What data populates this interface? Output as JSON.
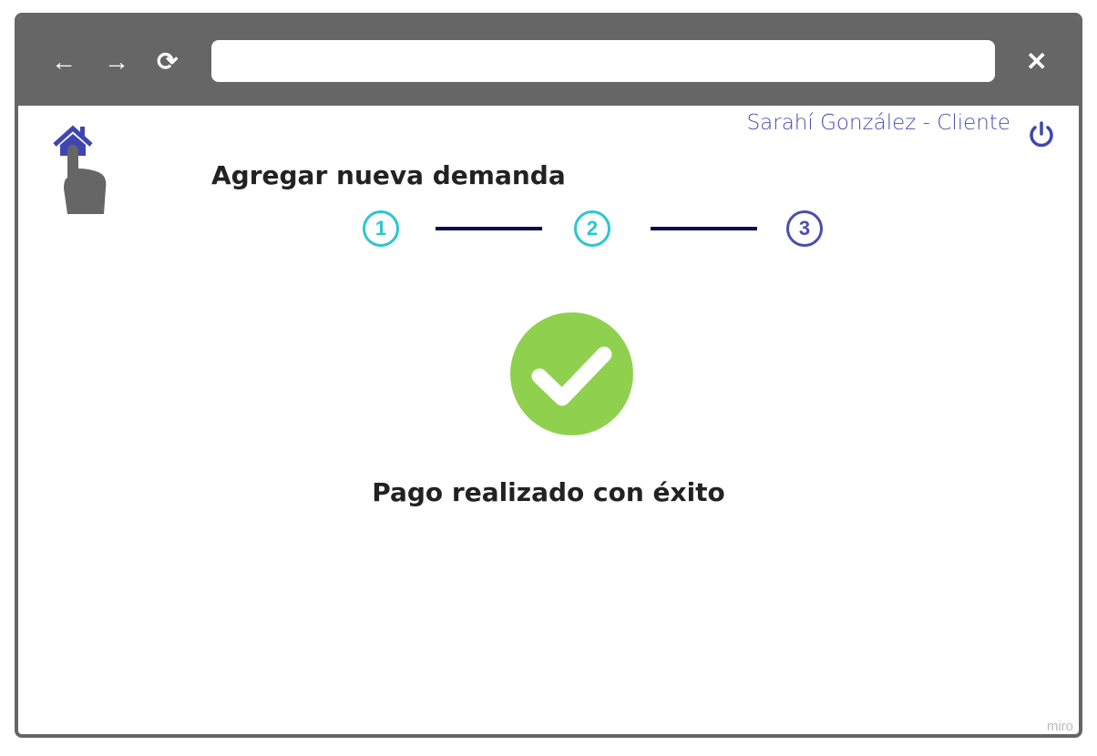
{
  "browser": {
    "back_icon": "←",
    "forward_icon": "→",
    "reload_icon": "⟳",
    "close_icon": "✕",
    "url": ""
  },
  "header": {
    "user": "Sarahí González - Cliente"
  },
  "page": {
    "title": "Agregar nueva demanda",
    "steps": [
      "1",
      "2",
      "3"
    ],
    "message": "Pago realizado con éxito"
  },
  "watermark": "miro",
  "colors": {
    "step_done": "#2ac7cf",
    "step_current": "#4a4fae",
    "success": "#8fd14f"
  }
}
